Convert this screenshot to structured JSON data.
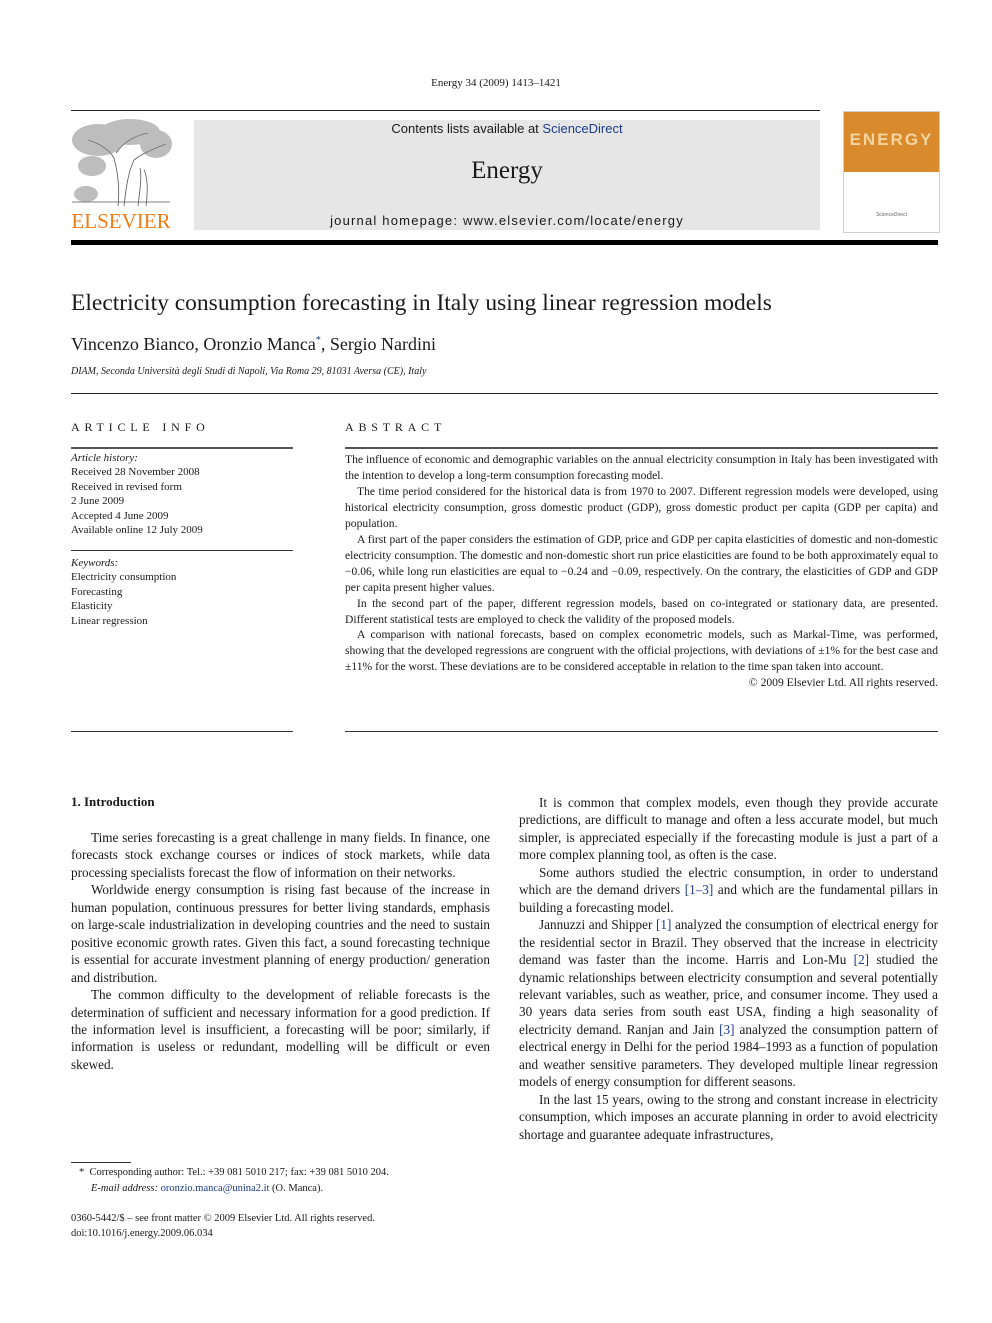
{
  "running_head": "Energy 34 (2009) 1413–1421",
  "masthead": {
    "contents_prefix": "Contents lists available at ",
    "contents_link": "ScienceDirect",
    "journal_title": "Energy",
    "homepage": "journal homepage: www.elsevier.com/locate/energy",
    "publisher_logo_text": "ELSEVIER",
    "cover_word": "ENERGY",
    "cover_footer": "ScienceDirect",
    "colors": {
      "publisher_orange": "#f07c16",
      "cover_orange": "#d88a2c",
      "link_blue": "#1b3a8c",
      "masthead_gray": "#e6e6e6"
    }
  },
  "article": {
    "title": "Electricity consumption forecasting in Italy using linear regression models",
    "authors_part1": "Vincenzo Bianco, Oronzio Manca",
    "authors_mark": "*",
    "authors_part2": ", Sergio Nardini",
    "affiliation": "DIAM, Seconda Università degli Studi di Napoli, Via Roma 29, 81031 Aversa (CE), Italy"
  },
  "article_info": {
    "heading": "ARTICLE INFO",
    "history_label": "Article history:",
    "history": [
      "Received 28 November 2008",
      "Received in revised form",
      "2 June 2009",
      "Accepted 4 June 2009",
      "Available online 12 July 2009"
    ],
    "keywords_label": "Keywords:",
    "keywords": [
      "Electricity consumption",
      "Forecasting",
      "Elasticity",
      "Linear regression"
    ]
  },
  "abstract": {
    "heading": "ABSTRACT",
    "paragraphs": [
      "The influence of economic and demographic variables on the annual electricity consumption in Italy has been investigated with the intention to develop a long-term consumption forecasting model.",
      "The time period considered for the historical data is from 1970 to 2007. Different regression models were developed, using historical electricity consumption, gross domestic product (GDP), gross domestic product per capita (GDP per capita) and population.",
      "A first part of the paper considers the estimation of GDP, price and GDP per capita elasticities of domestic and non-domestic electricity consumption. The domestic and non-domestic short run price elasticities are found to be both approximately equal to −0.06, while long run elasticities are equal to −0.24 and −0.09, respectively. On the contrary, the elasticities of GDP and GDP per capita present higher values.",
      "In the second part of the paper, different regression models, based on co-integrated or stationary data, are presented. Different statistical tests are employed to check the validity of the proposed models.",
      "A comparison with national forecasts, based on complex econometric models, such as Markal-Time, was performed, showing that the developed regressions are congruent with the official projections, with deviations of ±1% for the best case and ±11% for the worst. These deviations are to be considered acceptable in relation to the time span taken into account."
    ],
    "copyright": "© 2009 Elsevier Ltd. All rights reserved."
  },
  "body": {
    "section_heading": "1.  Introduction",
    "left_paragraphs": [
      "Time series forecasting is a great challenge in many fields. In finance, one forecasts stock exchange courses or indices of stock markets, while data processing specialists forecast the flow of information on their networks.",
      "Worldwide energy consumption is rising fast because of the increase in human population, continuous pressures for better living standards, emphasis on large-scale industrialization in developing countries and the need to sustain positive economic growth rates. Given this fact, a sound forecasting technique is essential for accurate investment planning of energy production/ generation and distribution.",
      "The common difficulty to the development of reliable forecasts is the determination of sufficient and necessary information for a good prediction. If the information level is insufficient, a forecasting will be poor; similarly, if information is useless or redundant, modelling will be difficult or even skewed."
    ],
    "right": {
      "p1": "It is common that complex models, even though they provide accurate predictions, are difficult to manage and often a less accurate model, but much simpler, is appreciated especially if the forecasting module is just a part of a more complex planning tool, as often is the case.",
      "p2_a": "Some authors studied the electric consumption, in order to understand which are the demand drivers ",
      "p2_cite": "[1–3]",
      "p2_b": " and which are the fundamental pillars in building a forecasting model.",
      "p3_a": "Jannuzzi and Shipper ",
      "p3_cite1": "[1]",
      "p3_b": " analyzed the consumption of electrical energy for the residential sector in Brazil. They observed that the increase in electricity demand was faster than the income. Harris and Lon-Mu ",
      "p3_cite2": "[2]",
      "p3_c": " studied the dynamic relationships between electricity consumption and several potentially relevant variables, such as weather, price, and consumer income. They used a 30 years data series from south east USA, finding a high seasonality of electricity demand. Ranjan and Jain ",
      "p3_cite3": "[3]",
      "p3_d": " analyzed the consumption pattern of electrical energy in Delhi for the period 1984–1993 as a function of population and weather sensitive parameters. They developed multiple linear regression models of energy consumption for different seasons.",
      "p4": "In the last 15 years, owing to the strong and constant increase in electricity consumption, which imposes an accurate planning in order to avoid electricity shortage and guarantee adequate infrastructures,"
    }
  },
  "footnote": {
    "mark": "*",
    "contact": "Corresponding author: Tel.: +39 081 5010 217; fax: +39 081 5010 204.",
    "email_label": "E-mail address: ",
    "email": "oronzio.manca@unina2.it",
    "email_suffix": " (O. Manca)."
  },
  "front_matter": {
    "issn_line": "0360-5442/$ – see front matter © 2009 Elsevier Ltd. All rights reserved.",
    "doi": "doi:10.1016/j.energy.2009.06.034"
  }
}
